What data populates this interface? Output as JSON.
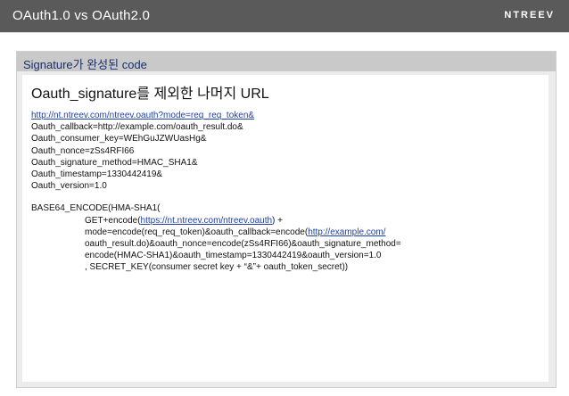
{
  "header": {
    "title": "OAuth1.0 vs OAuth2.0",
    "brand": "NTREEV"
  },
  "panel": {
    "title": "Signature가 완성된 code",
    "heading": "Oauth_signature를 제외한 나머지 URL",
    "url_lines": [
      "http://nt.ntreev.com/ntreev.oauth?mode=req_req_token&",
      "Oauth_callback=http://example.com/oauth_result.do&",
      "Oauth_consumer_key=WEhGuJZWUasHg&",
      "Oauth_nonce=zSs4RFI66",
      "Oauth_signature_method=HMAC_SHA1&",
      "Oauth_timestamp=1330442419&",
      "Oauth_version=1.0"
    ],
    "code": {
      "line1": "BASE64_ENCODE(HMA-SHA1(",
      "line2_prefix": "GET+encode(",
      "line2_link": "https://nt.ntreev.com/ntreev.oauth",
      "line2_suffix": ") +",
      "line3_prefix": "mode=encode(req_req_token)&oauth_callback=encode(",
      "line3_link": "http://example.com/",
      "line4": "oauth_result.do)&oauth_nonce=encode(zSs4RFI66)&oauth_signature_method=",
      "line5": "encode(HMAC-SHA1)&oauth_timestamp=1330442419&oauth_version=1.0",
      "line6": ", SECRET_KEY(consumer secret key + “&”+ oauth_token_secret))"
    }
  },
  "colors": {
    "top_bar": "#5a5a5a",
    "panel_header": "#c9c9c9",
    "panel_title_text": "#1a2f6a",
    "link": "#1f3fa8"
  }
}
